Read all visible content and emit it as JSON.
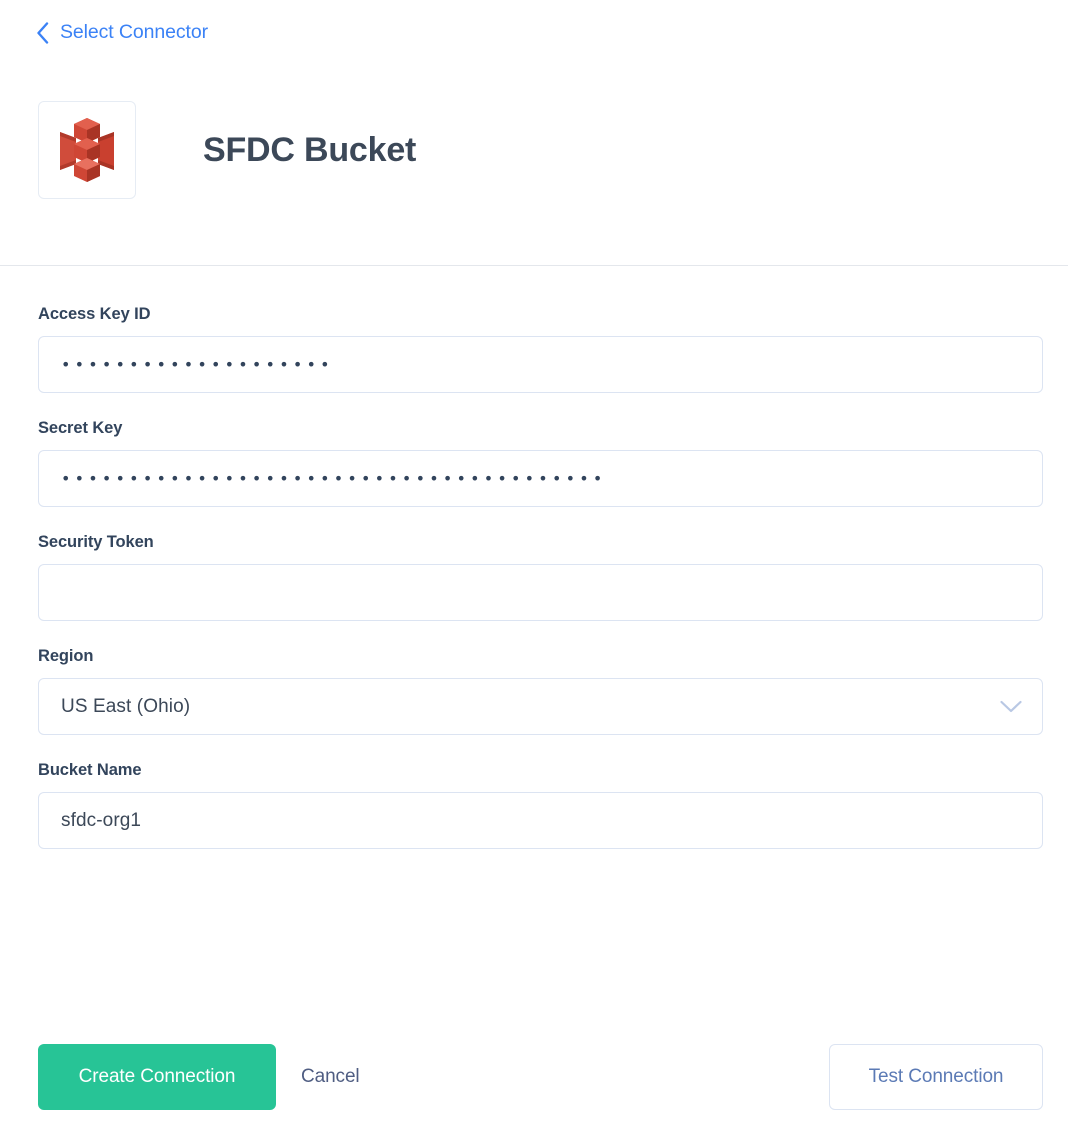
{
  "nav": {
    "back_label": "Select Connector",
    "back_icon": "chevron-left-icon",
    "accent_color": "#3b82f6"
  },
  "header": {
    "title": "SFDC Bucket",
    "icon": "aws-s3-bucket-icon",
    "icon_color": "#c9402f"
  },
  "form": {
    "fields": [
      {
        "label": "Access Key ID",
        "type": "password",
        "value": "••••••••••••••••••••",
        "placeholder": ""
      },
      {
        "label": "Secret Key",
        "type": "password",
        "value": "••••••••••••••••••••••••••••••••••••••••",
        "placeholder": ""
      },
      {
        "label": "Security Token",
        "type": "text",
        "value": "",
        "placeholder": ""
      },
      {
        "label": "Region",
        "type": "select",
        "value": "US East (Ohio)",
        "placeholder": "",
        "icon": "chevron-down-icon"
      },
      {
        "label": "Bucket Name",
        "type": "text",
        "value": "sfdc-org1",
        "placeholder": ""
      }
    ]
  },
  "actions": {
    "create_label": "Create Connection",
    "cancel_label": "Cancel",
    "test_label": "Test Connection",
    "primary_color": "#27c496"
  }
}
